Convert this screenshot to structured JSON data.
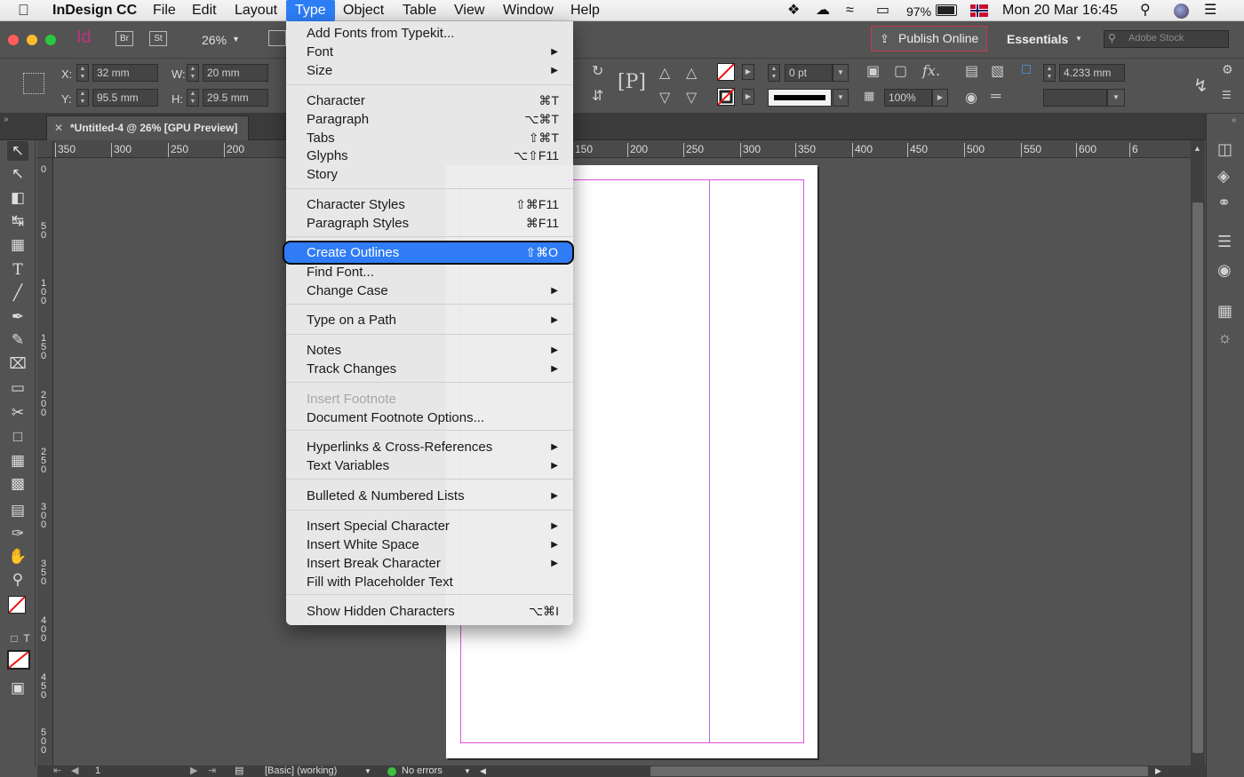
{
  "menubar": {
    "app_name": "InDesign CC",
    "menus": [
      "File",
      "Edit",
      "Layout",
      "Type",
      "Object",
      "Table",
      "View",
      "Window",
      "Help"
    ],
    "active_menu": "Type",
    "battery": "97%",
    "datetime": "Mon 20 Mar  16:45"
  },
  "appbar": {
    "app_logo": "Id",
    "bridge": "Br",
    "stock": "St",
    "zoom": "26%",
    "publish_online": "Publish Online",
    "workspace": "Essentials",
    "search_placeholder": "Adobe Stock"
  },
  "control": {
    "x_label": "X:",
    "x_value": "32 mm",
    "y_label": "Y:",
    "y_value": "95.5 mm",
    "w_label": "W:",
    "w_value": "20 mm",
    "h_label": "H:",
    "h_value": "29.5 mm",
    "stroke_weight": "0 pt",
    "opacity": "100%",
    "gap": "4.233 mm"
  },
  "document_tab": "*Untitled-4 @ 26% [GPU Preview]",
  "hruler_ticks": [
    "350",
    "300",
    "250",
    "200",
    "150",
    "200",
    "250",
    "300",
    "350",
    "400",
    "450",
    "500",
    "550",
    "600",
    "6"
  ],
  "vruler_ticks": [
    "0",
    "5\n0",
    "1\n0\n0",
    "1\n5\n0",
    "2\n0\n0",
    "2\n5\n0",
    "3\n0\n0",
    "3\n5\n0",
    "4\n0\n0",
    "4\n5\n0",
    "5\n0\n0"
  ],
  "type_menu": {
    "items": [
      {
        "label": "Add Fonts from Typekit...",
        "shortcut": "",
        "submenu": false,
        "disabled": false
      },
      {
        "label": "Font",
        "shortcut": "",
        "submenu": true,
        "disabled": false
      },
      {
        "label": "Size",
        "shortcut": "",
        "submenu": true,
        "disabled": false
      },
      {
        "label": "Character",
        "shortcut": "⌘T",
        "submenu": false,
        "disabled": false
      },
      {
        "label": "Paragraph",
        "shortcut": "⌥⌘T",
        "submenu": false,
        "disabled": false
      },
      {
        "label": "Tabs",
        "shortcut": "⇧⌘T",
        "submenu": false,
        "disabled": false
      },
      {
        "label": "Glyphs",
        "shortcut": "⌥⇧F11",
        "submenu": false,
        "disabled": false
      },
      {
        "label": "Story",
        "shortcut": "",
        "submenu": false,
        "disabled": false
      },
      {
        "label": "Character Styles",
        "shortcut": "⇧⌘F11",
        "submenu": false,
        "disabled": false
      },
      {
        "label": "Paragraph Styles",
        "shortcut": "⌘F11",
        "submenu": false,
        "disabled": false
      },
      {
        "label": "Create Outlines",
        "shortcut": "⇧⌘O",
        "submenu": false,
        "disabled": false,
        "highlighted": true
      },
      {
        "label": "Find Font...",
        "shortcut": "",
        "submenu": false,
        "disabled": false
      },
      {
        "label": "Change Case",
        "shortcut": "",
        "submenu": true,
        "disabled": false
      },
      {
        "label": "Type on a Path",
        "shortcut": "",
        "submenu": true,
        "disabled": false
      },
      {
        "label": "Notes",
        "shortcut": "",
        "submenu": true,
        "disabled": false
      },
      {
        "label": "Track Changes",
        "shortcut": "",
        "submenu": true,
        "disabled": false
      },
      {
        "label": "Insert Footnote",
        "shortcut": "",
        "submenu": false,
        "disabled": true
      },
      {
        "label": "Document Footnote Options...",
        "shortcut": "",
        "submenu": false,
        "disabled": false
      },
      {
        "label": "Hyperlinks & Cross-References",
        "shortcut": "",
        "submenu": true,
        "disabled": false
      },
      {
        "label": "Text Variables",
        "shortcut": "",
        "submenu": true,
        "disabled": false
      },
      {
        "label": "Bulleted & Numbered Lists",
        "shortcut": "",
        "submenu": true,
        "disabled": false
      },
      {
        "label": "Insert Special Character",
        "shortcut": "",
        "submenu": true,
        "disabled": false
      },
      {
        "label": "Insert White Space",
        "shortcut": "",
        "submenu": true,
        "disabled": false
      },
      {
        "label": "Insert Break Character",
        "shortcut": "",
        "submenu": true,
        "disabled": false
      },
      {
        "label": "Fill with Placeholder Text",
        "shortcut": "",
        "submenu": false,
        "disabled": false
      },
      {
        "label": "Show Hidden Characters",
        "shortcut": "⌥⌘I",
        "submenu": false,
        "disabled": false
      }
    ],
    "submenu_arrow": "▶"
  },
  "statusbar": {
    "page": "1",
    "style": "[Basic] (working)",
    "preflight": "No errors"
  },
  "colors": {
    "accent": "#2f7cf6",
    "margin_guide": "#e14ee1",
    "chrome": "#535353",
    "preflight_ok": "#3ec03e"
  }
}
